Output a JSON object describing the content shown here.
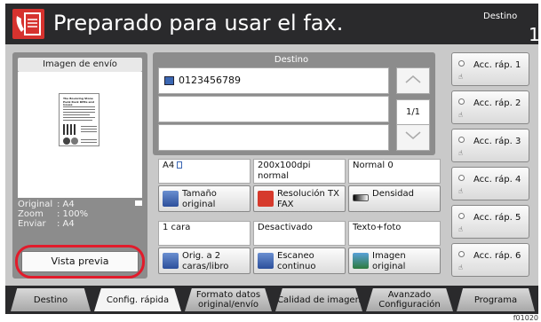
{
  "header": {
    "title": "Preparado para usar el fax.",
    "destino_label": "Destino",
    "destino_count": "1"
  },
  "preview": {
    "header": "Imagen de envío",
    "original_label": "Original",
    "original_value": ": A4",
    "zoom_label": "Zoom",
    "zoom_value": ": 100%",
    "enviar_label": "Enviar",
    "enviar_value": ": A4",
    "button_label": "Vista previa"
  },
  "destination": {
    "header": "Destino",
    "entries": [
      "0123456789",
      "",
      ""
    ],
    "page_indicator": "1/1"
  },
  "settings": [
    {
      "value": "A4",
      "button": "Tamaño original",
      "icon": "size-icon"
    },
    {
      "value": "200x100dpi normal",
      "button": "Resolución TX FAX",
      "icon": "resolution-icon"
    },
    {
      "value": "Normal 0",
      "button": "Densidad",
      "icon": "density-icon"
    },
    {
      "value": "1 cara",
      "button": "Orig. a 2 caras/libro",
      "icon": "duplex-icon"
    },
    {
      "value": "Desactivado",
      "button": "Escaneo continuo",
      "icon": "continuous-scan-icon"
    },
    {
      "value": "Texto+foto",
      "button": "Imagen original",
      "icon": "original-image-icon"
    }
  ],
  "quick_dial": [
    "Acc. ráp. 1",
    "Acc. ráp. 2",
    "Acc. ráp. 3",
    "Acc. ráp. 4",
    "Acc. ráp. 5",
    "Acc. ráp. 6"
  ],
  "tabs": [
    "Destino",
    "Config. rápida",
    "Formato datos original/envío",
    "Calidad de imagen",
    "Avanzado Configuración",
    "Programa"
  ],
  "active_tab": "Config. rápida",
  "footnote": "f01020",
  "colors": {
    "header_bg": "#2a2a2c",
    "accent_red": "#e21b2b",
    "panel_bg": "#c9c9c9"
  }
}
